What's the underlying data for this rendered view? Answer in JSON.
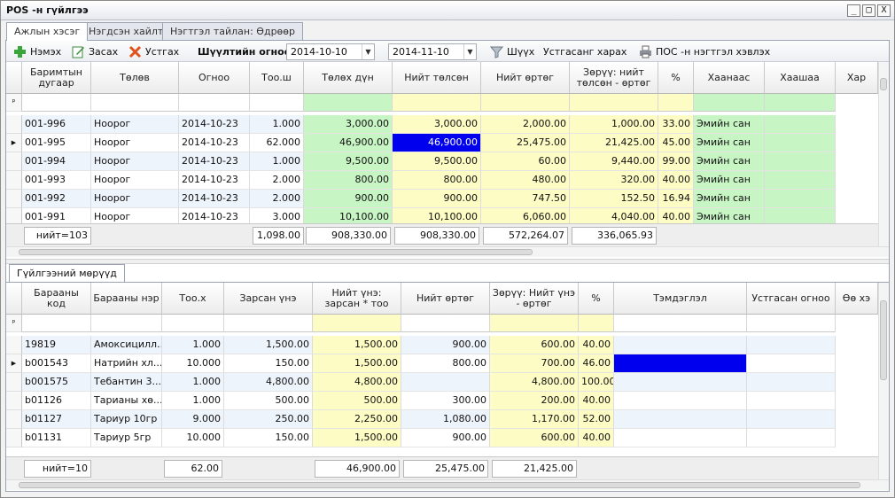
{
  "window": {
    "title": "POS -н гүйлгээ",
    "btn_min": "_",
    "btn_max": "□",
    "btn_close": "X"
  },
  "tabs": [
    {
      "label": "Ажлын хэсэг"
    },
    {
      "label": "Нэгдсэн хайлт"
    },
    {
      "label": "Нэгтгэл тайлан: Өдрөөр"
    }
  ],
  "toolbar": {
    "add": "Нэмэх",
    "edit": "Засах",
    "delete": "Устгах",
    "filter_label": "Шүүлтийн огноо:",
    "date_from": "2014-10-10",
    "date_to": "2014-11-10",
    "filter_btn": "Шүүх",
    "deleted_view": "Устгасанг харах",
    "pos_print": "ПОС -н нэгтгэл хэвлэх"
  },
  "colors": {
    "green": "#c8f5c4",
    "yellow": "#fdfcc4",
    "selected": "#0000ee"
  },
  "top_grid": {
    "columns": [
      "Баримтын дугаар",
      "Төлөв",
      "Огноо",
      "Тоо.ш",
      "Төлөх дүн",
      "Нийт төлсөн",
      "Нийт өртөг",
      "Зөрүү: нийт төлсөн - өртөг",
      "%",
      "Хаанаас",
      "Хаашаа",
      "Хар"
    ],
    "rows": [
      [
        "001-996",
        "Ноорог",
        "2014-10-23",
        "1.000",
        "3,000.00",
        "3,000.00",
        "2,000.00",
        "1,000.00",
        "33.00",
        "Эмийн сан",
        ""
      ],
      [
        "001-995",
        "Ноорог",
        "2014-10-23",
        "62.000",
        "46,900.00",
        "46,900.00",
        "25,475.00",
        "21,425.00",
        "45.00",
        "Эмийн сан",
        ""
      ],
      [
        "001-994",
        "Ноорог",
        "2014-10-23",
        "1.000",
        "9,500.00",
        "9,500.00",
        "60.00",
        "9,440.00",
        "99.00",
        "Эмийн сан",
        ""
      ],
      [
        "001-993",
        "Ноорог",
        "2014-10-23",
        "2.000",
        "800.00",
        "800.00",
        "480.00",
        "320.00",
        "40.00",
        "Эмийн сан",
        ""
      ],
      [
        "001-992",
        "Ноорог",
        "2014-10-23",
        "2.000",
        "900.00",
        "900.00",
        "747.50",
        "152.50",
        "16.94",
        "Эмийн сан",
        ""
      ],
      [
        "001-991",
        "Ноорог",
        "2014-10-23",
        "3.000",
        "10,100.00",
        "10,100.00",
        "6,060.00",
        "4,040.00",
        "40.00",
        "Эмийн сан",
        ""
      ]
    ],
    "footer": {
      "count": "нийт=103",
      "qty": "1,098.00",
      "pay": "908,330.00",
      "paid": "908,330.00",
      "cost": "572,264.07",
      "diff": "336,065.93"
    }
  },
  "bottom_tab": "Гүйлгээний мөрүүд",
  "bottom_grid": {
    "columns": [
      "Барааны код",
      "Барааны нэр",
      "Тоо.х",
      "Зарсан үнэ",
      "Нийт үнэ: зарсан * тоо",
      "Нийт өртөг",
      "Зөрүү: Нийт үнэ - өртөг",
      "%",
      "Тэмдэглэл",
      "Устгасан огноо",
      "Өө хэ"
    ],
    "rows": [
      [
        "19819",
        "Амоксицилл...",
        "1.000",
        "1,500.00",
        "1,500.00",
        "900.00",
        "600.00",
        "40.00",
        "",
        ""
      ],
      [
        "b001543",
        "Натрийн хл...",
        "10.000",
        "150.00",
        "1,500.00",
        "800.00",
        "700.00",
        "46.00",
        "",
        ""
      ],
      [
        "b001575",
        "Тебантин 3...",
        "1.000",
        "4,800.00",
        "4,800.00",
        "",
        "4,800.00",
        "100.00",
        "",
        ""
      ],
      [
        "b01126",
        "Тарианы хө...",
        "1.000",
        "500.00",
        "500.00",
        "300.00",
        "200.00",
        "40.00",
        "",
        ""
      ],
      [
        "b01127",
        "Тариур 10гр",
        "9.000",
        "250.00",
        "2,250.00",
        "1,080.00",
        "1,170.00",
        "52.00",
        "",
        ""
      ],
      [
        "b01131",
        "Тариур 5гр",
        "10.000",
        "150.00",
        "1,500.00",
        "900.00",
        "600.00",
        "40.00",
        "",
        ""
      ]
    ],
    "footer": {
      "count": "нийт=10",
      "qty": "62.00",
      "total": "46,900.00",
      "cost": "25,475.00",
      "diff": "21,425.00"
    }
  }
}
